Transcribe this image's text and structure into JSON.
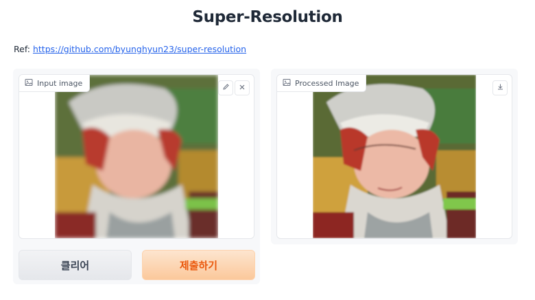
{
  "page": {
    "title": "Super-Resolution",
    "ref_label": "Ref:",
    "ref_link": "https://github.com/byunghyun23/super-resolution"
  },
  "input_panel": {
    "label": "Input image",
    "icons": {
      "edit": "pencil-icon",
      "clear": "close-icon",
      "image": "image-icon"
    }
  },
  "output_panel": {
    "label": "Processed Image",
    "icons": {
      "download": "download-icon",
      "image": "image-icon"
    }
  },
  "buttons": {
    "clear_label": "클리어",
    "submit_label": "제출하기"
  },
  "colors": {
    "accent": "#ea580c",
    "link": "#2563eb"
  }
}
